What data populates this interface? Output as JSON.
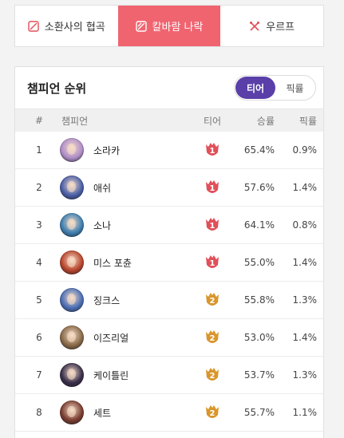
{
  "modes": [
    {
      "label": "소환사의 협곡",
      "icon": "summoners-rift-icon",
      "active": false
    },
    {
      "label": "칼바람 나락",
      "icon": "aram-icon",
      "active": true
    },
    {
      "label": "우르프",
      "icon": "urf-icon",
      "active": false
    }
  ],
  "ranking": {
    "title": "챔피언 순위",
    "toggle": {
      "tier_label": "티어",
      "pick_label": "픽률"
    },
    "headers": {
      "rank": "#",
      "champion": "챔피언",
      "tier": "티어",
      "winrate": "승률",
      "pickrate": "픽률"
    },
    "rows": [
      {
        "rank": "1",
        "name": "소라카",
        "tier": "1",
        "winrate": "65.4%",
        "pickrate": "0.9%",
        "avatar_color": "#b08fc8"
      },
      {
        "rank": "2",
        "name": "애쉬",
        "tier": "1",
        "winrate": "57.6%",
        "pickrate": "1.4%",
        "avatar_color": "#4a5fa8"
      },
      {
        "rank": "3",
        "name": "소나",
        "tier": "1",
        "winrate": "64.1%",
        "pickrate": "0.8%",
        "avatar_color": "#3f7fb0"
      },
      {
        "rank": "4",
        "name": "미스 포츈",
        "tier": "1",
        "winrate": "55.0%",
        "pickrate": "1.4%",
        "avatar_color": "#b9452d"
      },
      {
        "rank": "5",
        "name": "징크스",
        "tier": "2",
        "winrate": "55.8%",
        "pickrate": "1.3%",
        "avatar_color": "#4b6fb5"
      },
      {
        "rank": "6",
        "name": "이즈리얼",
        "tier": "2",
        "winrate": "53.0%",
        "pickrate": "1.4%",
        "avatar_color": "#8a6a48"
      },
      {
        "rank": "7",
        "name": "케이틀린",
        "tier": "2",
        "winrate": "53.7%",
        "pickrate": "1.3%",
        "avatar_color": "#3a2f4a"
      },
      {
        "rank": "8",
        "name": "세트",
        "tier": "2",
        "winrate": "55.7%",
        "pickrate": "1.1%",
        "avatar_color": "#7a3d30"
      }
    ]
  },
  "colors": {
    "accent_mode": "#f06470",
    "accent_toggle": "#5a3fa9",
    "tier1": "#e0505a",
    "tier2": "#d9962b"
  }
}
